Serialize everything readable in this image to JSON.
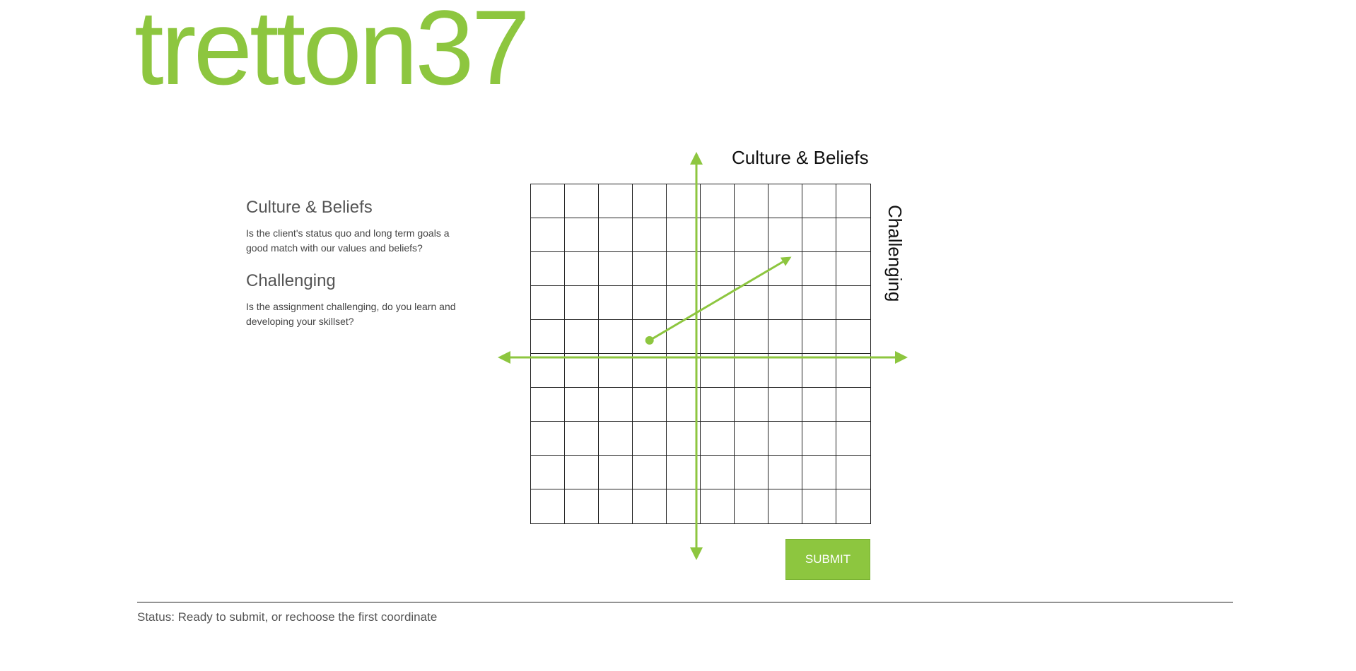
{
  "brand": {
    "logo_text": "tretton37",
    "accent_color": "#8dc63f"
  },
  "info": {
    "sections": [
      {
        "title": "Culture & Beliefs",
        "description": "Is the client's status quo and long term goals a good match with our values and beliefs?"
      },
      {
        "title": "Challenging",
        "description": "Is the assignment challenging, do you learn and developing your skillset?"
      }
    ]
  },
  "chart": {
    "y_axis_label": "Culture & Beliefs",
    "x_axis_label": "Challenging",
    "grid_columns": 10,
    "grid_rows": 10,
    "axis_color": "#8dc63f",
    "selection": {
      "start_cell": {
        "column": 4,
        "row": 5
      },
      "end_cell": {
        "column": 8,
        "row": 3
      }
    }
  },
  "actions": {
    "submit_label": "SUBMIT"
  },
  "status": {
    "text": "Status: Ready to submit, or rechoose the first coordinate"
  }
}
